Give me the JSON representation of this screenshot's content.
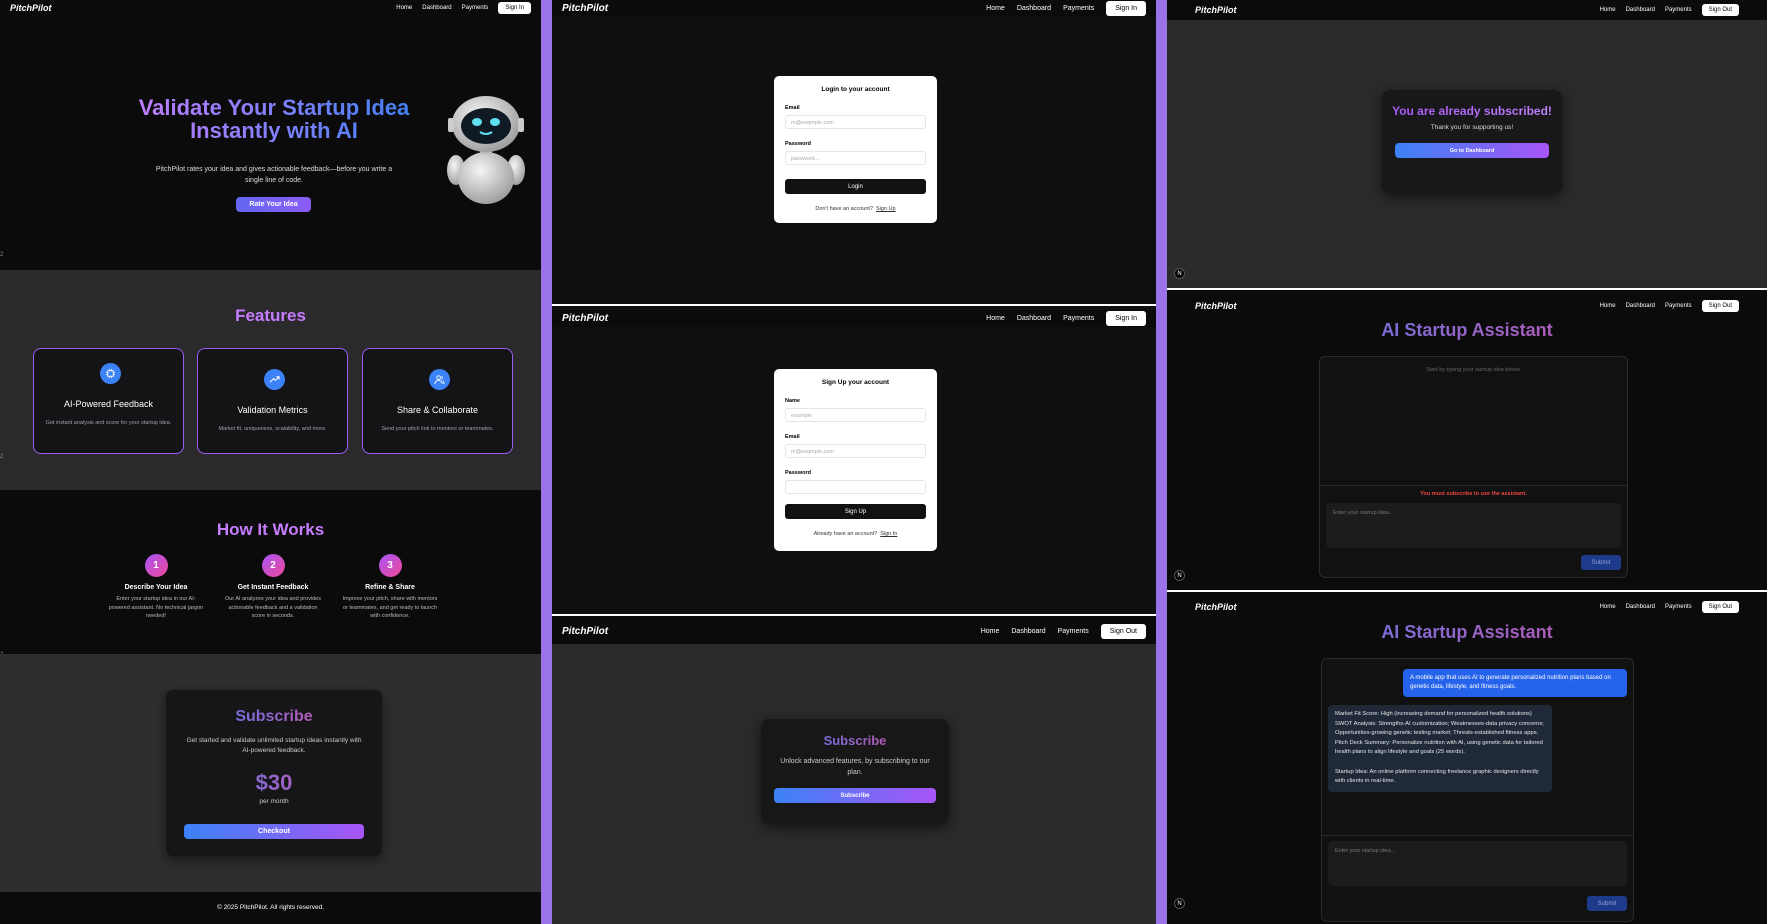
{
  "nav": {
    "logo": "PitchPilot",
    "home": "Home",
    "dashboard": "Dashboard",
    "payments": "Payments",
    "sign_in": "Sign In",
    "sign_out": "Sign Out"
  },
  "landing": {
    "hero_title": "Validate Your Startup Idea Instantly with AI",
    "hero_sub": "PitchPilot rates your idea and gives actionable feedback—before you write a single line of code.",
    "hero_cta": "Rate Your Idea",
    "features_title": "Features",
    "features": [
      {
        "icon": "chip-icon",
        "title": "AI-Powered Feedback",
        "desc": "Get instant analysis and score for your startup idea."
      },
      {
        "icon": "trending-up-icon",
        "title": "Validation Metrics",
        "desc": "Market fit, uniqueness, scalability, and more."
      },
      {
        "icon": "users-icon",
        "title": "Share & Collaborate",
        "desc": "Send your pitch link to mentors or teammates."
      }
    ],
    "how_title": "How It Works",
    "steps": [
      {
        "num": "1",
        "title": "Describe Your Idea",
        "desc": "Enter your startup idea in our AI-powered assistant. No technical jargon needed!"
      },
      {
        "num": "2",
        "title": "Get Instant Feedback",
        "desc": "Our AI analyzes your idea and provides actionable feedback and a validation score in seconds."
      },
      {
        "num": "3",
        "title": "Refine & Share",
        "desc": "Improve your pitch, share with mentors or teammates, and get ready to launch with confidence."
      }
    ],
    "subscribe_title": "Subscribe",
    "subscribe_desc": "Get started and validate unlimited startup ideas instantly with AI-powered feedback.",
    "price": "$30",
    "per": "per month",
    "checkout": "Checkout",
    "footer": "© 2025 PitchPilot. All rights reserved."
  },
  "login": {
    "title": "Login to your account",
    "email_label": "Email",
    "email_placeholder": "m@example.com",
    "password_label": "Password",
    "password_placeholder": "password...",
    "button": "Login",
    "switch_text": "Don't have an account?",
    "switch_link": "Sign Up"
  },
  "signup": {
    "title": "Sign Up your account",
    "name_label": "Name",
    "name_placeholder": "example",
    "email_label": "Email",
    "email_placeholder": "m@example.com",
    "password_label": "Password",
    "button": "Sign Up",
    "switch_text": "Already have an account?",
    "switch_link": "Sign In"
  },
  "payment": {
    "title": "Subscribe",
    "desc": "Unlock advanced features, by subscribing to our plan.",
    "button": "Subscribe"
  },
  "already": {
    "title": "You are already subscribed!",
    "desc": "Thank you for supporting us!",
    "button": "Go to Dashboard"
  },
  "assistant": {
    "title": "AI Startup Assistant",
    "empty_hint": "Start by typing your startup idea below.",
    "warning": "You must subscribe to use the assistant.",
    "placeholder": "Enter your startup idea...",
    "submit": "Submit",
    "user_msg": "A mobile app that uses AI to generate personalized nutrition plans based on genetic data, lifestyle, and fitness goals.",
    "ai_lines": [
      "Market Fit Score: High (increasing demand for personalized health solutions)",
      "SWOT Analysis: Strengths-AI customization; Weaknesses-data privacy concerns; Opportunities-growing genetic testing market; Threats-established fitness apps.",
      "Pitch Deck Summary: Personalize nutrition with AI, using genetic data for tailored health plans to align lifestyle and goals (25 words).",
      "",
      "Startup Idea: An online platform connecting freelance graphic designers directly with clients in real-time."
    ]
  },
  "badge": "N",
  "colors": {
    "accent": "#9a73e8",
    "blue": "#3b82f6",
    "purple": "#a855f7",
    "pink": "#ec4899"
  }
}
